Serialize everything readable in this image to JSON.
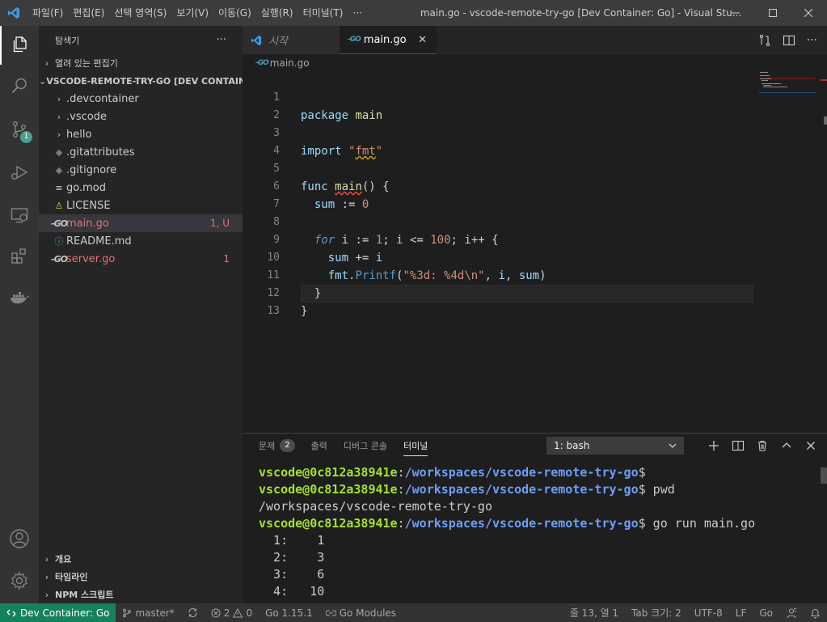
{
  "titlebar": {
    "menu": [
      "파일(F)",
      "편집(E)",
      "선택 영역(S)",
      "보기(V)",
      "이동(G)",
      "실행(R)",
      "터미널(T)",
      "···"
    ],
    "title": "main.go - vscode-remote-try-go [Dev Container: Go] - Visual Stu..."
  },
  "activitybar": {
    "scm_badge": "1"
  },
  "sidebar": {
    "title": "탐색기",
    "more": "···",
    "open_editors": "열려 있는 편집기",
    "project": "VSCODE-REMOTE-TRY-GO [DEV CONTAIN...",
    "items": [
      {
        "label": ".devcontainer",
        "icon": "chevron-right",
        "status": ""
      },
      {
        "label": ".vscode",
        "icon": "chevron-right",
        "status": ""
      },
      {
        "label": "hello",
        "icon": "chevron-right",
        "status": ""
      },
      {
        "label": ".gitattributes",
        "icon": "diamond",
        "status": ""
      },
      {
        "label": ".gitignore",
        "icon": "diamond",
        "status": ""
      },
      {
        "label": "go.mod",
        "icon": "lines",
        "status": ""
      },
      {
        "label": "LICENSE",
        "icon": "person",
        "status": ""
      },
      {
        "label": "main.go",
        "icon": "go",
        "status": "1, U"
      },
      {
        "label": "README.md",
        "icon": "info",
        "status": ""
      },
      {
        "label": "server.go",
        "icon": "go",
        "status": "1"
      }
    ],
    "bottom_sections": [
      "개요",
      "타임라인",
      "NPM 스크립트"
    ]
  },
  "tabs": [
    {
      "label": "시작",
      "active": false
    },
    {
      "label": "main.go",
      "active": true
    }
  ],
  "go_icon_text": "-GO",
  "breadcrumb": "main.go",
  "code": {
    "line_numbers": [
      "1",
      "2",
      "3",
      "4",
      "5",
      "6",
      "7",
      "8",
      "9",
      "10",
      "11",
      "12",
      "13"
    ]
  },
  "panel": {
    "tabs": [
      {
        "label": "문제",
        "badge": "2"
      },
      {
        "label": "출력"
      },
      {
        "label": "디버그 콘솔"
      },
      {
        "label": "터미널"
      }
    ],
    "terminal_select": "1: bash",
    "terminal": {
      "user": "vscode@0c812a38941e",
      "path": "/workspaces/vscode-remote-try-go",
      "cmd_pwd": " pwd",
      "pwd_output": "/workspaces/vscode-remote-try-go",
      "cmd_run": " go run main.go",
      "output": [
        "  1:    1",
        "  2:    3",
        "  3:    6",
        "  4:   10"
      ]
    }
  },
  "statusbar": {
    "remote": "Dev Container: Go",
    "branch": "master*",
    "errors": "2",
    "warnings": "0",
    "go_version": "Go 1.15.1",
    "go_modules": "Go Modules",
    "position": "줄 13, 열 1",
    "tab_size": "Tab 크기: 2",
    "encoding": "UTF-8",
    "eol": "LF",
    "language": "Go"
  }
}
